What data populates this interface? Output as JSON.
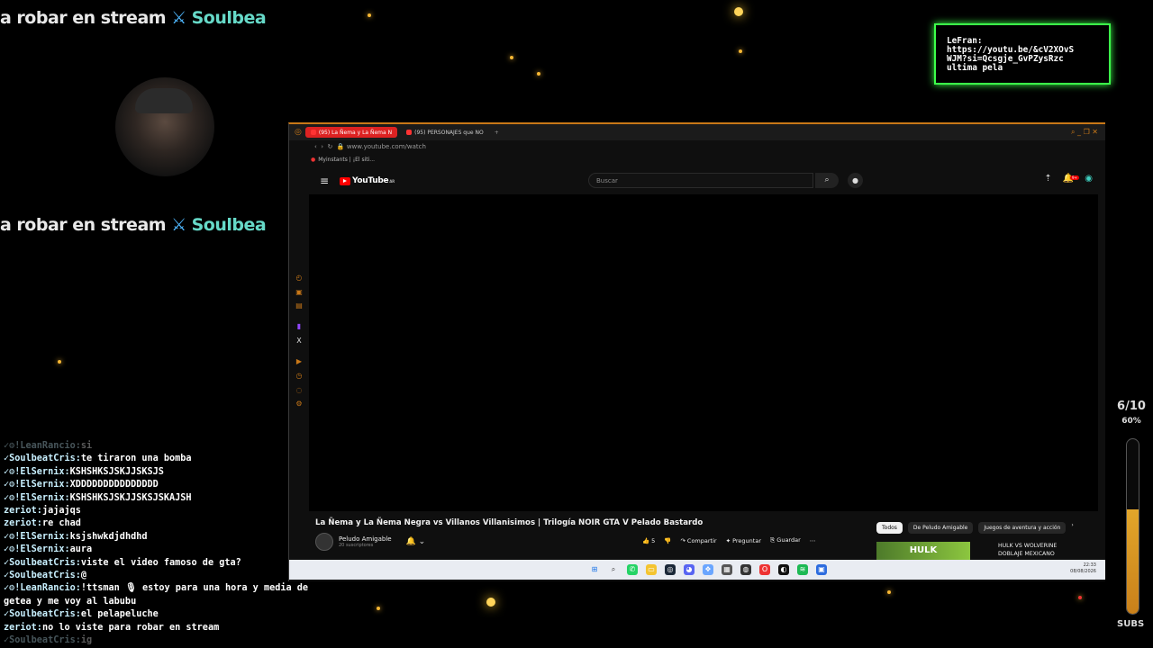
{
  "overlay": {
    "marquee_left": "a robar en stream",
    "marquee_sword": "⚔",
    "marquee_right": "Soulbea",
    "notice_lines": [
      "LeFran:",
      "https://youtu.be/&cV2XOvS",
      "WJM?si=Qcsgje_GvPZysRzc",
      "ultima pela"
    ]
  },
  "browser": {
    "tabs": [
      "(95) La Ñema y La Ñema N",
      "(95) PERSONAJES que NO"
    ],
    "url": "www.youtube.com/watch",
    "bookmark": "Myinstants | ¡El siti..."
  },
  "youtube": {
    "logo": "YouTube",
    "logo_sup": "AR",
    "search_placeholder": "Buscar",
    "notif_badge": "9+",
    "video_title": "La Ñema y La Ñema Negra vs Villanos Villanisimos | Trilogía NOIR GTA V Pelado Bastardo",
    "channel_name": "Peludo Amigable",
    "channel_subs": "20 suscriptores",
    "likes": "5",
    "share": "Compartir",
    "ask": "Preguntar",
    "save": "Guardar",
    "chips": [
      "Todos",
      "De Peludo Amigable",
      "Juegos de aventura y acción"
    ],
    "rec_thumb_text": "HULK",
    "rec_title_1": "HULK VS WOLVERINE",
    "rec_title_2": "DOBLAJE MEXICANO",
    "clock_time": "22:33",
    "clock_date": "08/08/2026"
  },
  "chat": [
    {
      "user": "✓⚙!LeanRancio:",
      "msg": "si",
      "dim": true
    },
    {
      "user": "✓SoulbeatCris:",
      "msg": "te tiraron una bomba"
    },
    {
      "user": "✓⚙!ElSernix:",
      "msg": "KSHSHKSJSKJJSKSJS"
    },
    {
      "user": "✓⚙!ElSernix:",
      "msg": "XDDDDDDDDDDDDDDD"
    },
    {
      "user": "✓⚙!ElSernix:",
      "msg": "KSHSHKSJSKJJSKSJSKAJSH"
    },
    {
      "user": "zeriot:",
      "msg": "jajajqs"
    },
    {
      "user": "zeriot:",
      "msg": "re chad"
    },
    {
      "user": "✓⚙!ElSernix:",
      "msg": "ksjshwkdjdhdhd"
    },
    {
      "user": "✓⚙!ElSernix:",
      "msg": "aura"
    },
    {
      "user": "✓SoulbeatCris:",
      "msg": "viste el video famoso de gta?"
    },
    {
      "user": "✓SoulbeatCris:",
      "msg": "@"
    },
    {
      "user": "✓⚙!LeanRancio:",
      "msg": "!ttsman 🎙 estoy para una hora y media de"
    },
    {
      "user": "",
      "msg": "getea y me voy al labubu"
    },
    {
      "user": "✓SoulbeatCris:",
      "msg": "el pelapeluche"
    },
    {
      "user": "zeriot:",
      "msg": "no lo viste para robar en stream"
    },
    {
      "user": "✓SoulbeatCris:",
      "msg": "ig",
      "dim": true
    }
  ],
  "goal": {
    "count": "6/10",
    "percent": "60%",
    "fill_fraction": 0.6,
    "label": "SUBS"
  },
  "colors": {
    "notice_border": "#3cff4a",
    "browser_accent": "#c97818",
    "star": "#f7b733"
  }
}
